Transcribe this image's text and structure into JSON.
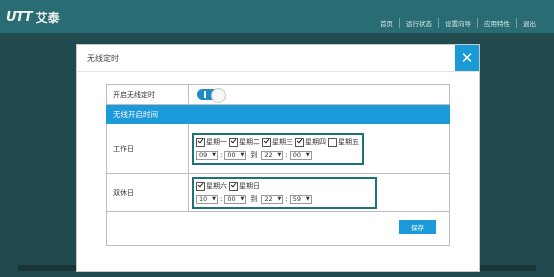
{
  "app": {
    "logo_mark": "UTT",
    "brand": "艾泰",
    "nav": [
      "首页",
      "运行状态",
      "设置向导",
      "应用特性",
      "退出"
    ]
  },
  "dialog": {
    "title": "无线定时",
    "close_icon": "close-icon",
    "enable_label": "开启无线定时",
    "enable_state": true,
    "section_header": "无线开启时间",
    "workday": {
      "label": "工作日",
      "days": [
        {
          "name": "星期一",
          "checked": true
        },
        {
          "name": "星期二",
          "checked": true
        },
        {
          "name": "星期三",
          "checked": true
        },
        {
          "name": "星期四",
          "checked": true
        },
        {
          "name": "星期五",
          "checked": false
        }
      ],
      "start_hour": "09",
      "start_min": "00",
      "to": "到",
      "end_hour": "22",
      "end_min": "00"
    },
    "weekend": {
      "label": "双休日",
      "days": [
        {
          "name": "星期六",
          "checked": true
        },
        {
          "name": "星期日",
          "checked": true
        }
      ],
      "start_hour": "10",
      "start_min": "00",
      "to": "到",
      "end_hour": "22",
      "end_min": "59"
    },
    "save_label": "保存"
  },
  "colors": {
    "topbar": "#2a6c74",
    "accent": "#1c9ad9",
    "schedule_border": "#1c7378"
  }
}
